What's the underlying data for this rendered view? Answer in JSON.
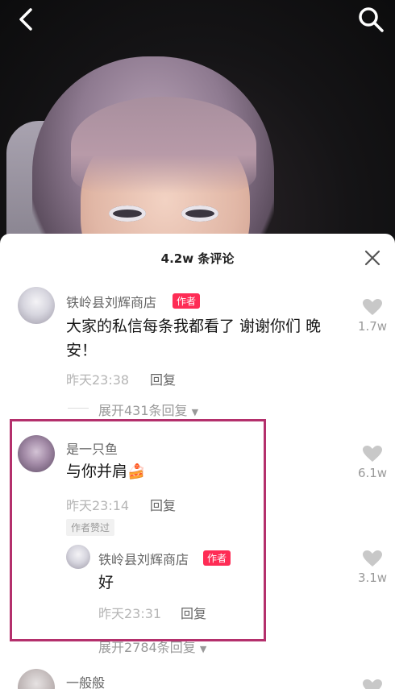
{
  "video": {
    "back_icon": "chevron-left-icon",
    "search_icon": "search-icon"
  },
  "sheet": {
    "title": "4.2w 条评论",
    "close_icon": "close-icon"
  },
  "comments": [
    {
      "name": "铁岭县刘辉商店",
      "tag": "作者",
      "text_line1": "大家的私信每条我都看了 谢谢你们 晚",
      "text_line2": "安！",
      "time": "昨天23:38",
      "reply_label": "回复",
      "likes": "1.7w",
      "expand": "展开431条回复"
    },
    {
      "name": "是一只鱼",
      "text": "与你并肩",
      "emoji": "🍰",
      "time": "昨天23:14",
      "reply_label": "回复",
      "badge": "作者赞过",
      "likes": "6.1w",
      "reply": {
        "name": "铁岭县刘辉商店",
        "tag": "作者",
        "text": "好",
        "time": "昨天23:31",
        "reply_label": "回复",
        "likes": "3.1w"
      },
      "expand": "展开2784条回复"
    },
    {
      "name": "一般般"
    }
  ],
  "colors": {
    "author_tag": "#fe2c55",
    "highlight_border": "#b4306c"
  }
}
